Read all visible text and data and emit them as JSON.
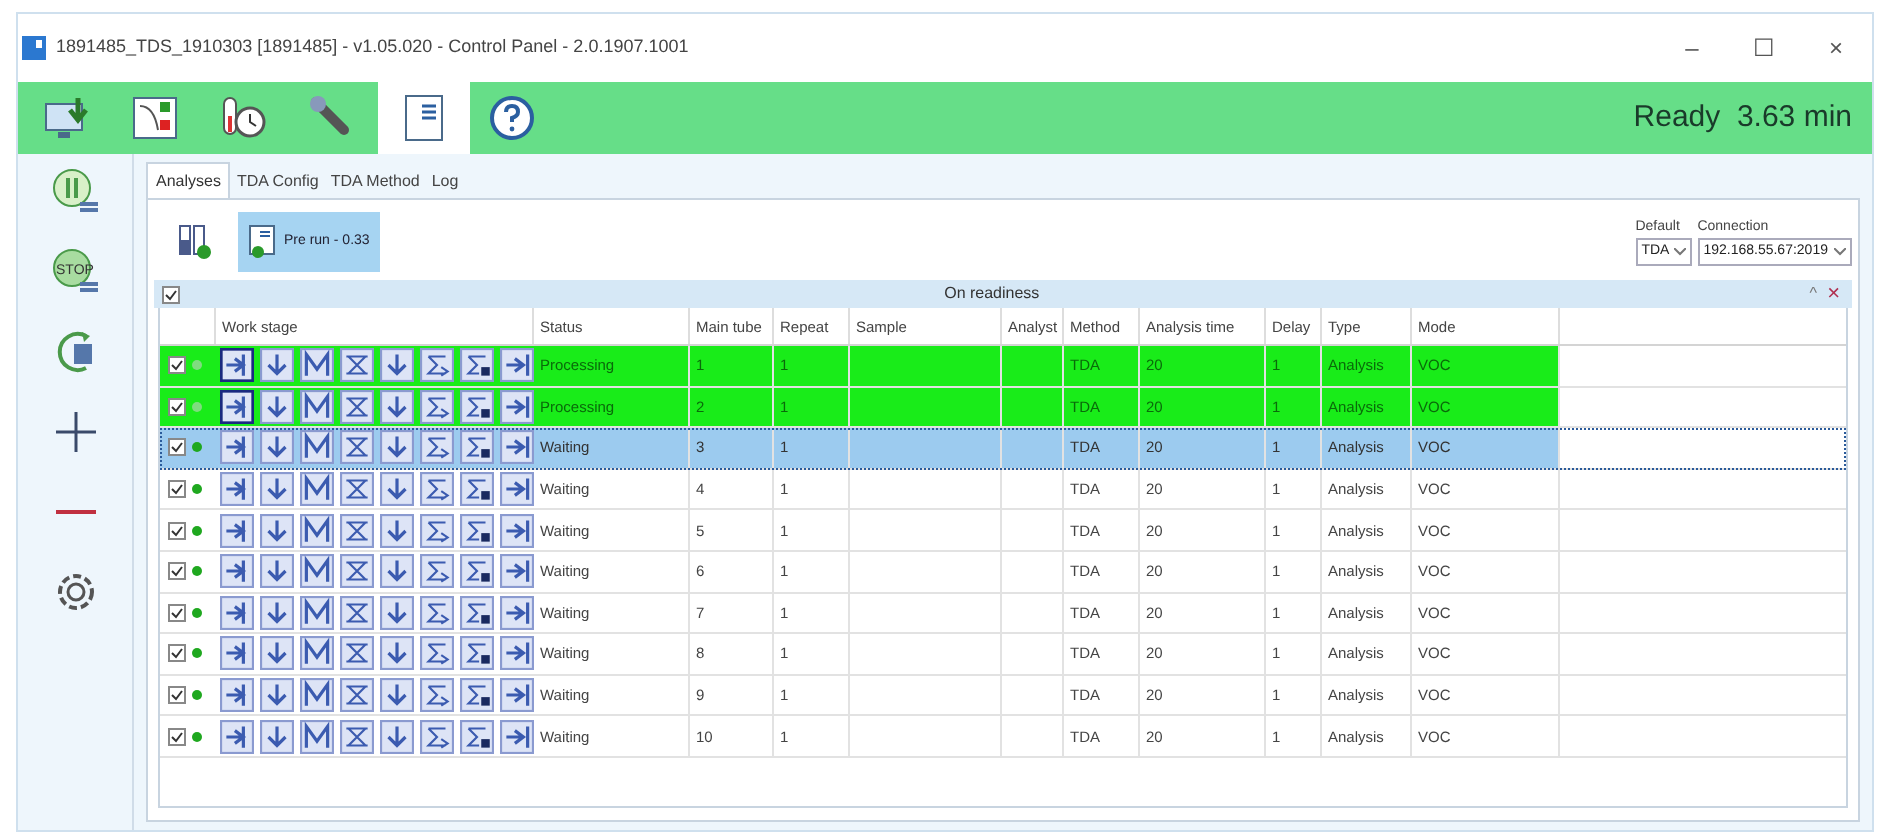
{
  "window": {
    "title": "1891485_TDS_1910303 [1891485] - v1.05.020 - Control Panel - 2.0.1907.1001",
    "controls": [
      "–",
      "☐",
      "×"
    ]
  },
  "toolbar": {
    "status": "Ready  3.63 min",
    "tools": [
      {
        "kind": "import",
        "selected": false
      },
      {
        "kind": "chart",
        "selected": false
      },
      {
        "kind": "timer",
        "selected": false
      },
      {
        "kind": "wrench",
        "selected": false
      },
      {
        "kind": "document",
        "selected": true
      },
      {
        "kind": "help",
        "selected": false
      }
    ]
  },
  "sidebar": {
    "stop_label": "STOP",
    "items": [
      {
        "kind": "pause"
      },
      {
        "kind": "stop"
      },
      {
        "kind": "restart"
      },
      {
        "kind": "add"
      },
      {
        "kind": "remove"
      },
      {
        "kind": "settings"
      }
    ]
  },
  "tabs": [
    {
      "label": "Analyses",
      "selected": true
    },
    {
      "label": "TDA Config",
      "selected": false
    },
    {
      "label": "TDA Method",
      "selected": false
    },
    {
      "label": "Log",
      "selected": false
    }
  ],
  "prerun": {
    "label": "Pre run - 0.33",
    "selected": true
  },
  "default": {
    "label": "Default",
    "value": "TDA"
  },
  "connection": {
    "label": "Connection",
    "value": "192.168.55.67:2019"
  },
  "group": {
    "title": "On readiness",
    "checked": true,
    "collapse": "^",
    "close": "×"
  },
  "table": {
    "columns": [
      "Work stage",
      "Status",
      "Main tube",
      "Repeat",
      "Sample",
      "Analyst",
      "Method",
      "Analysis time",
      "Delay",
      "Type",
      "Mode"
    ],
    "rows": [
      {
        "processing": true,
        "selected": false,
        "checked": true,
        "color": "#7fdc7f",
        "cells": [
          "",
          "Processing",
          "1",
          "1",
          "",
          "",
          "TDA",
          "20",
          "1",
          "Analysis",
          "VOC"
        ]
      },
      {
        "processing": true,
        "selected": false,
        "checked": true,
        "color": "#7fdc7f",
        "cells": [
          "",
          "Processing",
          "2",
          "1",
          "",
          "",
          "TDA",
          "20",
          "1",
          "Analysis",
          "VOC"
        ]
      },
      {
        "processing": false,
        "selected": true,
        "checked": true,
        "color": "#1fa81f",
        "cells": [
          "",
          "Waiting",
          "3",
          "1",
          "",
          "",
          "TDA",
          "20",
          "1",
          "Analysis",
          "VOC"
        ]
      },
      {
        "processing": false,
        "selected": false,
        "checked": true,
        "color": "#1fa81f",
        "cells": [
          "",
          "Waiting",
          "4",
          "1",
          "",
          "",
          "TDA",
          "20",
          "1",
          "Analysis",
          "VOC"
        ]
      },
      {
        "processing": false,
        "selected": false,
        "checked": true,
        "color": "#1fa81f",
        "cells": [
          "",
          "Waiting",
          "5",
          "1",
          "",
          "",
          "TDA",
          "20",
          "1",
          "Analysis",
          "VOC"
        ]
      },
      {
        "processing": false,
        "selected": false,
        "checked": true,
        "color": "#1fa81f",
        "cells": [
          "",
          "Waiting",
          "6",
          "1",
          "",
          "",
          "TDA",
          "20",
          "1",
          "Analysis",
          "VOC"
        ]
      },
      {
        "processing": false,
        "selected": false,
        "checked": true,
        "color": "#1fa81f",
        "cells": [
          "",
          "Waiting",
          "7",
          "1",
          "",
          "",
          "TDA",
          "20",
          "1",
          "Analysis",
          "VOC"
        ]
      },
      {
        "processing": false,
        "selected": false,
        "checked": true,
        "color": "#1fa81f",
        "cells": [
          "",
          "Waiting",
          "8",
          "1",
          "",
          "",
          "TDA",
          "20",
          "1",
          "Analysis",
          "VOC"
        ]
      },
      {
        "processing": false,
        "selected": false,
        "checked": true,
        "color": "#1fa81f",
        "cells": [
          "",
          "Waiting",
          "9",
          "1",
          "",
          "",
          "TDA",
          "20",
          "1",
          "Analysis",
          "VOC"
        ]
      },
      {
        "processing": false,
        "selected": false,
        "checked": true,
        "color": "#1fa81f",
        "cells": [
          "",
          "Waiting",
          "10",
          "1",
          "",
          "",
          "TDA",
          "20",
          "1",
          "Analysis",
          "VOC"
        ]
      }
    ]
  }
}
